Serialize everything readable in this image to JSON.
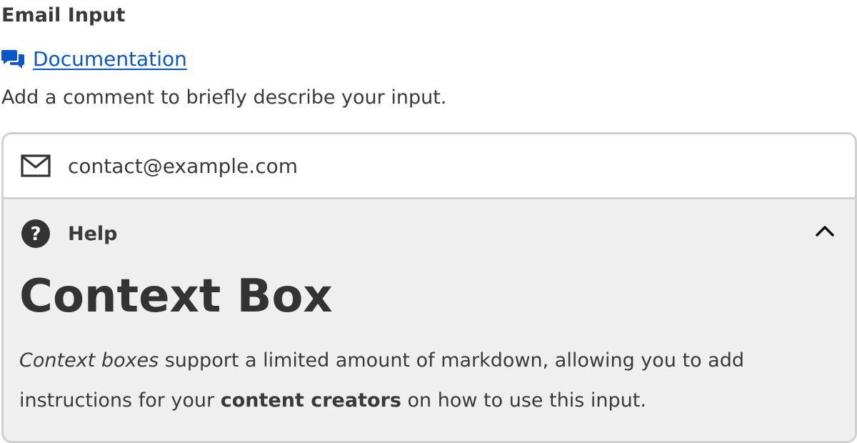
{
  "field": {
    "label": "Email Input",
    "documentation_link": "Documentation",
    "description": "Add a comment to briefly describe your input."
  },
  "input": {
    "value": "contact@example.com",
    "icon": "mail-icon"
  },
  "help": {
    "title": "Help",
    "icon": "question-circle-icon",
    "toggle_icon": "chevron-up-icon",
    "expanded": true,
    "heading": "Context Box",
    "body": {
      "italic_lead": "Context boxes",
      "text_1": " support a limited amount of markdown, allowing you to add instructions for your ",
      "bold_text": "content creators",
      "text_2": " on how to use this input."
    }
  },
  "colors": {
    "link": "#0c57c7",
    "border": "#d0d0d0",
    "help_background": "#efefef",
    "text": "#3a3a3a"
  }
}
